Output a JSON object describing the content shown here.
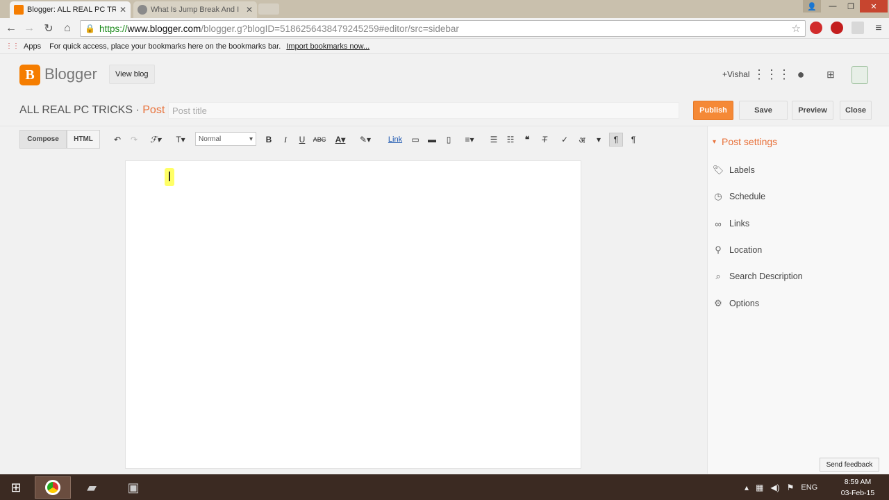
{
  "browser": {
    "tabs": [
      {
        "title": "Blogger: ALL REAL PC TR",
        "active": true
      },
      {
        "title": "What Is Jump Break And I",
        "active": false
      }
    ],
    "url": {
      "scheme": "https://",
      "host": "www.blogger.com",
      "path": "/blogger.g?blogID=5186256438479245259#editor/src=sidebar"
    },
    "bookmarks": {
      "apps_label": "Apps",
      "hint": "For quick access, place your bookmarks here on the bookmarks bar.",
      "import_link": "Import bookmarks now..."
    }
  },
  "blogger": {
    "brand": "Blogger",
    "view_blog": "View blog",
    "user": "+Vishal",
    "blog_name": "ALL REAL PC TRICKS",
    "separator": " · ",
    "post_label": "Post",
    "post_title_placeholder": "Post title",
    "buttons": {
      "publish": "Publish",
      "save": "Save",
      "preview": "Preview",
      "close": "Close"
    },
    "modes": {
      "compose": "Compose",
      "html": "HTML"
    },
    "format_select": "Normal",
    "link_label": "Link",
    "sidebar": {
      "header": "Post settings",
      "items": [
        {
          "label": "Labels",
          "icon": "tag-icon"
        },
        {
          "label": "Schedule",
          "icon": "clock-icon"
        },
        {
          "label": "Links",
          "icon": "link-icon"
        },
        {
          "label": "Location",
          "icon": "pin-icon"
        },
        {
          "label": "Search Description",
          "icon": "search-icon"
        },
        {
          "label": "Options",
          "icon": "gear-icon"
        }
      ]
    },
    "send_feedback": "Send feedback"
  },
  "taskbar": {
    "language": "ENG",
    "time": "8:59 AM",
    "date": "03-Feb-15"
  },
  "colors": {
    "accent": "#f58936",
    "brand": "#f57d00",
    "post_label": "#e8713a"
  }
}
